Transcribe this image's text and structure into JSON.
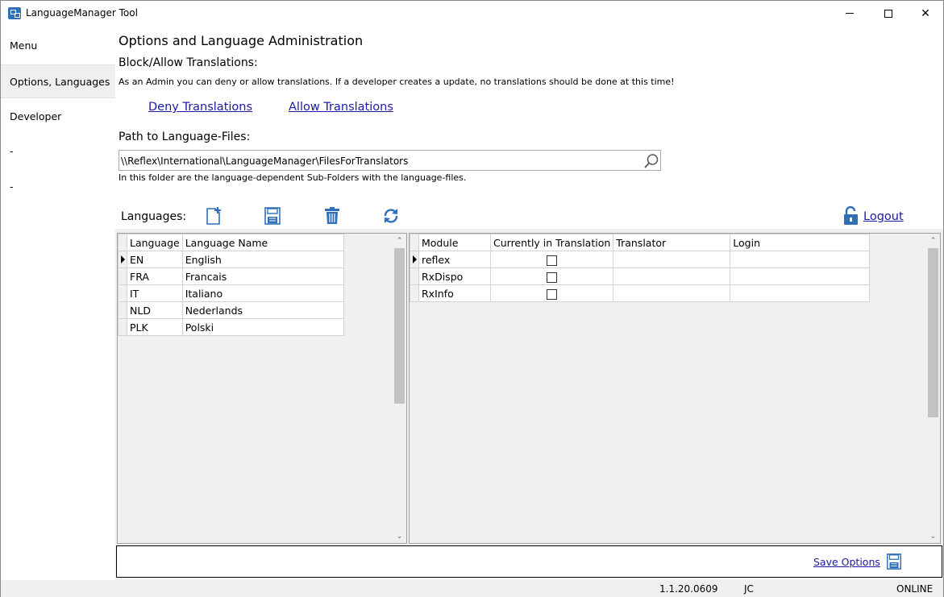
{
  "window": {
    "title": "LanguageManager Tool"
  },
  "sidebar": {
    "items": [
      {
        "label": "Menu"
      },
      {
        "label": "Options, Languages"
      },
      {
        "label": "Developer"
      },
      {
        "label": "-"
      },
      {
        "label": "-"
      }
    ]
  },
  "main": {
    "title": "Options and Language Administration",
    "block_heading": "Block/Allow Translations:",
    "block_description": "As an Admin you can deny or allow translations. If a developer creates a update, no translations should be done at this time!",
    "deny_label": "Deny Translations",
    "allow_label": "Allow Translations",
    "path_label": "Path to Language-Files:",
    "path_value": "\\\\Reflex\\International\\LanguageManager\\FilesForTranslators",
    "path_note": "In this folder are the language-dependent Sub-Folders with the language-files.",
    "languages_label": "Languages:",
    "logout_label": "Logout"
  },
  "languages_grid": {
    "headers": [
      "Language",
      "Language Name"
    ],
    "rows": [
      [
        "EN",
        "English"
      ],
      [
        "FRA",
        "Francais"
      ],
      [
        "IT",
        "Italiano"
      ],
      [
        "NLD",
        "Nederlands"
      ],
      [
        "PLK",
        "Polski"
      ]
    ]
  },
  "modules_grid": {
    "headers": [
      "Module",
      "Currently in Translation",
      "Translator",
      "Login"
    ],
    "rows": [
      {
        "module": "reflex",
        "in_translation": false,
        "translator": "",
        "login": ""
      },
      {
        "module": "RxDispo",
        "in_translation": false,
        "translator": "",
        "login": ""
      },
      {
        "module": "RxInfo",
        "in_translation": false,
        "translator": "",
        "login": ""
      }
    ]
  },
  "footer": {
    "save_label": "Save Options"
  },
  "statusbar": {
    "version": "1.1.20.0609",
    "user": "JC",
    "status": "ONLINE"
  },
  "colors": {
    "link": "#1a1aa6",
    "icon_blue": "#2f6fb7",
    "panel_bg": "#f0f0f0"
  }
}
